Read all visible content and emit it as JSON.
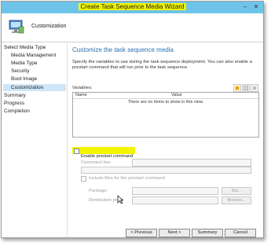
{
  "window": {
    "title": "Create Task Sequence Media Wizard"
  },
  "header": {
    "page_label": "Customization"
  },
  "nav": {
    "items": [
      {
        "label": "Select Media Type"
      },
      {
        "label": "Media Management"
      },
      {
        "label": "Media Type"
      },
      {
        "label": "Security"
      },
      {
        "label": "Boot Image"
      },
      {
        "label": "Customization"
      },
      {
        "label": "Summary"
      },
      {
        "label": "Progress"
      },
      {
        "label": "Completion"
      }
    ]
  },
  "content": {
    "title": "Customize the task sequence media",
    "description": "Specify the variables to use during the task sequence deployment. You can also enable a prestart command that will run prior to the task sequence.",
    "variables_label": "Variables:",
    "columns": [
      "Name",
      "Value"
    ],
    "empty_message": "There are no items to show in this view.",
    "prestart_checkbox": "Enable prestart command",
    "command_line_label": "Command line:",
    "include_files_label": "Include files for the prestart command",
    "package_label": "Package:",
    "distribution_point_label": "Distribution point:",
    "set_button": "Set...",
    "browse_button": "Browse..."
  },
  "footer": {
    "previous": "< Previous",
    "next": "Next >",
    "summary": "Summary",
    "cancel": "Cancel"
  },
  "colors": {
    "accent": "#2a6fb0",
    "titlebar": "#6ec4e8",
    "highlight": "#f2f400",
    "selection": "#cfe6f8"
  }
}
